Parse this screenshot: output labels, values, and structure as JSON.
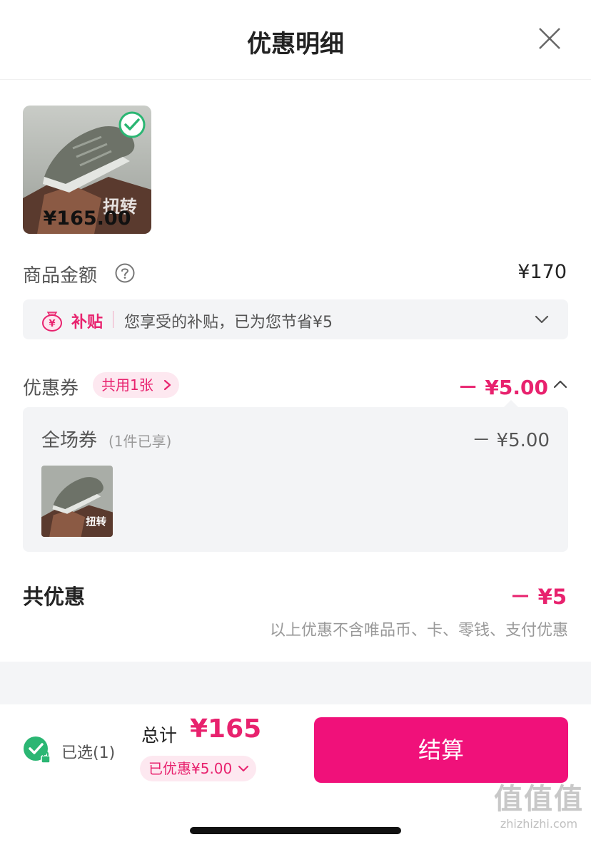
{
  "header": {
    "title": "优惠明细"
  },
  "product": {
    "price": "¥165.00",
    "thumb_text": "扭转"
  },
  "goods": {
    "label": "商品金额",
    "amount": "¥170"
  },
  "subsidy": {
    "tag": "补贴",
    "text": "您享受的补贴，已为您节省¥5"
  },
  "coupon": {
    "label": "优惠券",
    "badge": "共用1张",
    "amount": "－ ¥5.00"
  },
  "coupon_panel": {
    "label": "全场券",
    "sub": "(1件已享)",
    "amount": "－ ¥5.00",
    "thumb_text": "扭转"
  },
  "total": {
    "label": "共优惠",
    "amount": "－ ¥5",
    "note": "以上优惠不含唯品币、卡、零钱、支付优惠"
  },
  "footer": {
    "selected": "已选(1)",
    "sum_label": "总计",
    "sum_amount": "¥165",
    "saved": "已优惠¥5.00",
    "checkout": "结算"
  },
  "watermark": {
    "logo": "值值值",
    "url": "zhizhizhi.com"
  },
  "colors": {
    "accent": "#e8226e",
    "button": "#f0117a",
    "check": "#2bb673"
  }
}
